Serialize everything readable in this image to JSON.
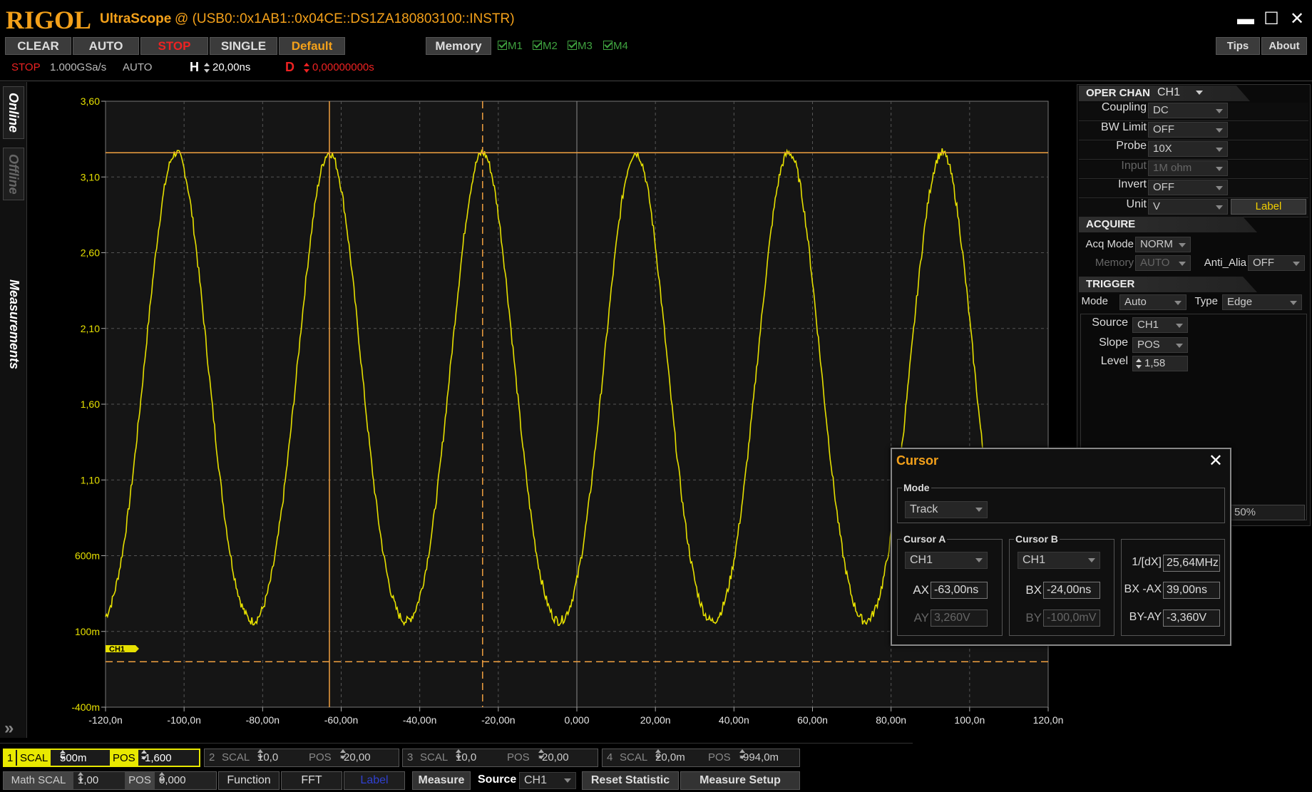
{
  "window": {
    "logo": "RIGOL",
    "app_name": "UltraScope",
    "resource": "@ (USB0::0x1AB1::0x04CE::DS1ZA180803100::INSTR)",
    "minimize": "▬",
    "maximize": "☐",
    "close": "✕"
  },
  "toolbar": {
    "clear": "CLEAR",
    "auto": "AUTO",
    "stop": "STOP",
    "single": "SINGLE",
    "default": "Default",
    "memory": "Memory",
    "m1": "M1",
    "m2": "M2",
    "m3": "M3",
    "m4": "M4",
    "tips": "Tips",
    "about": "About"
  },
  "status": {
    "run_state": "STOP",
    "sample_rate": "1.000GSa/s",
    "trigger_mode": "AUTO",
    "h_label": "H",
    "h_value": "20,00ns",
    "d_label": "D",
    "d_value": "0,00000000s"
  },
  "left_tabs": {
    "online": "Online",
    "offline": "Offline",
    "measurements": "Measurements",
    "expand": "»"
  },
  "plot": {
    "y_ticks": [
      "3,60",
      "3,10",
      "2,60",
      "2,10",
      "1,60",
      "1,10",
      "600m",
      "100m",
      "-400m"
    ],
    "x_ticks": [
      "-120,0n",
      "-100,0n",
      "-80,00n",
      "-60,00n",
      "-40,00n",
      "-20,00n",
      "0,000",
      "20,00n",
      "40,00n",
      "60,00n",
      "80,00n",
      "100,0n",
      "120,0n"
    ],
    "ch_marker": "CH1",
    "colors": {
      "trace": "#e6e000",
      "cursor": "#f0a040",
      "grid": "#555555",
      "axis_label": "#e6e000"
    }
  },
  "right_panel": {
    "oper_chan_label": "OPER CHAN",
    "oper_chan_value": "CH1",
    "coupling_label": "Coupling",
    "coupling_value": "DC",
    "bw_label": "BW Limit",
    "bw_value": "OFF",
    "probe_label": "Probe",
    "probe_value": "10X",
    "input_label": "Input",
    "input_value": "1M ohm",
    "invert_label": "Invert",
    "invert_value": "OFF",
    "unit_label": "Unit",
    "unit_value": "V",
    "label_button": "Label",
    "acquire_label": "ACQUIRE",
    "acq_mode_label": "Acq Mode",
    "acq_mode_value": "NORM",
    "memory_label": "Memory",
    "memory_value": "AUTO",
    "anti_alia_label": "Anti_Alia",
    "anti_alia_value": "OFF",
    "trigger_label": "TRIGGER",
    "mode_label": "Mode",
    "mode_value": "Auto",
    "type_label": "Type",
    "type_value": "Edge",
    "source_label": "Source",
    "source_value": "CH1",
    "slope_label": "Slope",
    "slope_value": "POS",
    "level_label": "Level",
    "level_value": "1,58",
    "percent": "50%"
  },
  "cursor_dialog": {
    "title": "Cursor",
    "close": "✕",
    "mode_label": "Mode",
    "mode_value": "Track",
    "cursor_a_label": "Cursor A",
    "cursor_a_source": "CH1",
    "ax_label": "AX",
    "ax_value": "-63,00ns",
    "ay_label": "AY",
    "ay_value": "3,260V",
    "cursor_b_label": "Cursor B",
    "cursor_b_source": "CH1",
    "bx_label": "BX",
    "bx_value": "-24,00ns",
    "by_label": "BY",
    "by_value": "-100,0mV",
    "inv_dx_label": "1/[dX]",
    "inv_dx_value": "25,64MHz",
    "bx_ax_label": "BX -AX",
    "bx_ax_value": "39,00ns",
    "by_ay_label": "BY-AY",
    "by_ay_value": "-3,360V"
  },
  "channels": [
    {
      "num": "1",
      "scal_label": "SCAL",
      "scal": "500m",
      "pos_label": "POS",
      "pos": "-1,600"
    },
    {
      "num": "2",
      "scal_label": "SCAL",
      "scal": "10,0",
      "pos_label": "POS",
      "pos": "-20,00"
    },
    {
      "num": "3",
      "scal_label": "SCAL",
      "scal": "10,0",
      "pos_label": "POS",
      "pos": "-20,00"
    },
    {
      "num": "4",
      "scal_label": "SCAL",
      "scal": "20,0m",
      "pos_label": "POS",
      "pos": "-994,0m"
    }
  ],
  "bottom": {
    "math_scal_label": "Math SCAL",
    "math_scal": "1,00",
    "math_pos_label": "POS",
    "math_pos": "0,000",
    "function": "Function",
    "fft": "FFT",
    "label": "Label",
    "measure": "Measure",
    "source_label": "Source",
    "source_value": "CH1",
    "reset_statistic": "Reset  Statistic",
    "measure_setup": "Measure Setup"
  }
}
